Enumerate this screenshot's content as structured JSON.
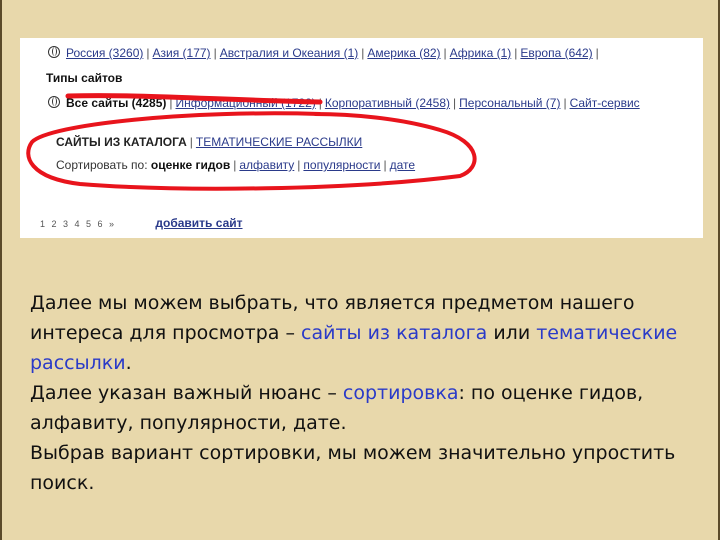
{
  "screenshot": {
    "regions_line": {
      "items": [
        "Россия (3260)",
        "Азия (177)",
        "Австралия и Океания (1)",
        "Америка (82)",
        "Африка (1)",
        "Европа (642)"
      ],
      "trailing_sep": "|"
    },
    "site_types_label": "Типы сайтов",
    "types_line": {
      "first_item": "Все сайты (4285)",
      "obscured_item": "Информационный (1722)",
      "items": [
        "Корпоративный (2458)",
        "Персональный (7)",
        "Сайт-сервис"
      ]
    },
    "catalog_header": {
      "active": "САЙТЫ ИЗ КАТАЛОГА",
      "separator": "|",
      "link": "ТЕМАТИЧЕСКИЕ РАССЫЛКИ"
    },
    "sort_line": {
      "prefix": "Сортировать по:",
      "active": "оценке гидов",
      "options": [
        "алфавиту",
        "популярности",
        "дате"
      ]
    },
    "pagination": "1 2 3 4 5 6 »",
    "add_site": "добавить сайт",
    "annotation_color": "#e8141c"
  },
  "paragraphs": [
    {
      "parts": [
        {
          "text": "Далее мы можем выбрать, что является предметом нашего интереса для просмотра – ",
          "hl": false
        },
        {
          "text": "сайты из каталога",
          "hl": true
        },
        {
          "text": " или ",
          "hl": false
        },
        {
          "text": "тематические рассылки",
          "hl": true
        },
        {
          "text": ".",
          "hl": false
        }
      ]
    },
    {
      "parts": [
        {
          "text": "Далее указан важный нюанс – ",
          "hl": false
        },
        {
          "text": "сортировка",
          "hl": true
        },
        {
          "text": ": по оценке гидов, алфавиту, популярности, дате.",
          "hl": false
        }
      ]
    },
    {
      "parts": [
        {
          "text": "Выбрав вариант сортировки, мы можем значительно упростить поиск.",
          "hl": false
        }
      ]
    }
  ],
  "colors": {
    "background": "#e8d8ab",
    "highlight": "#2a3ac8",
    "text": "#111111"
  }
}
